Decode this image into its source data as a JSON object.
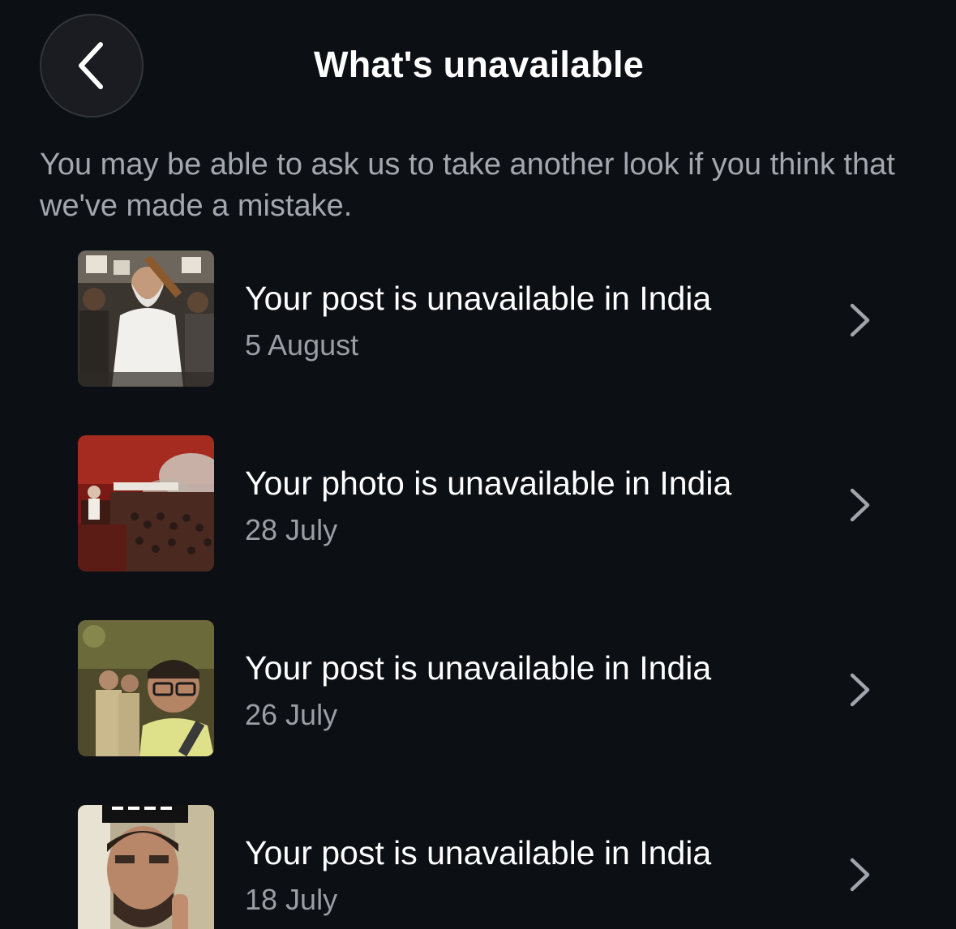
{
  "header": {
    "title": "What's unavailable",
    "back_icon": "chevron-left-icon"
  },
  "intro": {
    "text": "You may be able to ask us to take another look if you think that we've made a mistake."
  },
  "items": [
    {
      "title": "Your post is unavailable in India",
      "date": "5 August",
      "thumbnail": "protest-crowd-photo",
      "chevron_icon": "chevron-right-icon"
    },
    {
      "title": "Your photo is unavailable in India",
      "date": "28 July",
      "thumbnail": "red-crowd-illustration",
      "chevron_icon": "chevron-right-icon"
    },
    {
      "title": "Your post is unavailable in India",
      "date": "26 July",
      "thumbnail": "night-selfie-photo",
      "chevron_icon": "chevron-right-icon"
    },
    {
      "title": "Your post is unavailable in India",
      "date": "18 July",
      "thumbnail": "selfie-video-photo",
      "chevron_icon": "chevron-right-icon"
    }
  ],
  "colors": {
    "background": "#0c0f14",
    "title_text": "#ffffff",
    "secondary_text": "#9a9ea5",
    "chevron": "#a0a4ab"
  }
}
